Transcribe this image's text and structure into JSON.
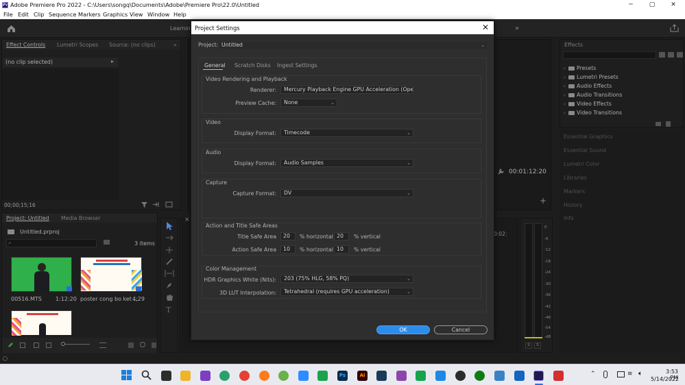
{
  "window": {
    "title": "Adobe Premiere Pro 2022 - C:\\Users\\songq\\Documents\\Adobe\\Premiere Pro\\22.0\\Untitled",
    "minimize": "─",
    "maximize": "▢",
    "close": "✕"
  },
  "menu": [
    "File",
    "Edit",
    "Clip",
    "Sequence",
    "Markers",
    "Graphics",
    "View",
    "Window",
    "Help"
  ],
  "header": {
    "workspace_label": "Learning",
    "more": "»"
  },
  "left_panel": {
    "tabs": [
      "Effect Controls",
      "Lumetri Scopes",
      "Source: (no clips)"
    ],
    "clip_selector": "(no clip selected)",
    "timecode": "00;00;15;16"
  },
  "project_panel": {
    "tabs": [
      "Project: Untitled",
      "Media Browser"
    ],
    "file_name": "Untitled.prproj",
    "item_count": "3 items",
    "items": [
      {
        "name": "00516.MTS",
        "duration": "1:12:20"
      },
      {
        "name": "poster cong bo ket ...",
        "duration": "4;29"
      }
    ]
  },
  "program_monitor": {
    "timecode": "00:01:12:20"
  },
  "timeline": {
    "timecode_partial": "0:02:"
  },
  "meter_scale": [
    "0",
    "-6",
    "-12",
    "-18",
    "-24",
    "-30",
    "-36",
    "-42",
    "-48",
    "-54",
    "-dB"
  ],
  "meter_solo": [
    "S",
    "S"
  ],
  "effects_panel": {
    "title": "Effects",
    "items": [
      "Presets",
      "Lumetri Presets",
      "Audio Effects",
      "Audio Transitions",
      "Video Effects",
      "Video Transitions"
    ],
    "other_panels": [
      "Essential Graphics",
      "Essential Sound",
      "Lumetri Color",
      "Libraries",
      "Markers",
      "History",
      "Info"
    ]
  },
  "dialog": {
    "title": "Project Settings",
    "project_label": "Project:",
    "project_value": "Untitled",
    "tabs": [
      "General",
      "Scratch Disks",
      "Ingest Settings"
    ],
    "sections": {
      "video_rendering": {
        "title": "Video Rendering and Playback",
        "renderer_label": "Renderer:",
        "renderer_value": "Mercury Playback Engine GPU Acceleration (OpenCL)",
        "preview_cache_label": "Preview Cache:",
        "preview_cache_value": "None"
      },
      "video": {
        "title": "Video",
        "display_format_label": "Display Format:",
        "display_format_value": "Timecode"
      },
      "audio": {
        "title": "Audio",
        "display_format_label": "Display Format:",
        "display_format_value": "Audio Samples"
      },
      "capture": {
        "title": "Capture",
        "capture_format_label": "Capture Format:",
        "capture_format_value": "DV"
      },
      "safe_areas": {
        "title": "Action and Title Safe Areas",
        "title_safe_label": "Title Safe Area",
        "title_h": "20",
        "title_v": "20",
        "action_safe_label": "Action Safe Area",
        "action_h": "10",
        "action_v": "10",
        "horizontal_unit": "% horizontal",
        "vertical_unit": "% vertical"
      },
      "color": {
        "title": "Color Management",
        "hdr_label": "HDR Graphics White (Nits):",
        "hdr_value": "203 (75% HLG, 58% PQ)",
        "lut_label": "3D LUT Interpolation:",
        "lut_value": "Tetrahedral (requires GPU acceleration)"
      }
    },
    "ok": "OK",
    "cancel": "Cancel",
    "close": "✕"
  },
  "taskbar": {
    "apps": [
      "Ps",
      "Ai"
    ],
    "time": "3:53 PM",
    "date": "5/14/2022"
  },
  "colors": {
    "accent_blue": "#2d8ceb",
    "dialog_bg": "#2e2e2e",
    "panel_bg": "#1e1e1e"
  }
}
